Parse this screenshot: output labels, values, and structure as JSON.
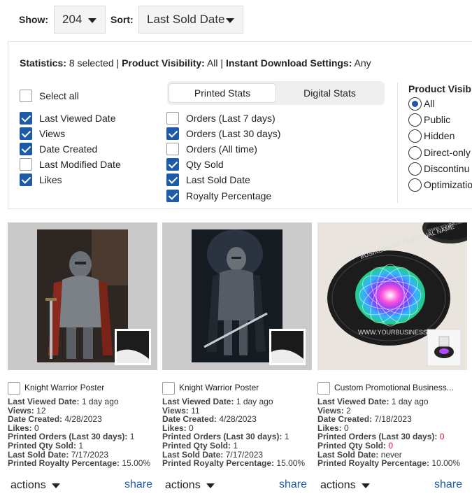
{
  "toolbar": {
    "show_label": "Show:",
    "show_value": "204",
    "sort_label": "Sort:",
    "sort_value": "Last Sold Date"
  },
  "summary": {
    "statistics_label": "Statistics:",
    "statistics_value": "8 selected",
    "sep1": "|",
    "visibility_label": "Product Visibility:",
    "visibility_value": "All",
    "sep2": "|",
    "download_label": "Instant Download Settings:",
    "download_value": "Any"
  },
  "general_stats": {
    "select_all": "Select all",
    "items": [
      {
        "label": "Last Viewed Date",
        "checked": true
      },
      {
        "label": "Views",
        "checked": true
      },
      {
        "label": "Date Created",
        "checked": true
      },
      {
        "label": "Last Modified Date",
        "checked": false
      },
      {
        "label": "Likes",
        "checked": true
      }
    ]
  },
  "tabs": [
    "Printed Stats",
    "Digital Stats"
  ],
  "printed_stats": [
    {
      "label": "Orders (Last 7 days)",
      "checked": false
    },
    {
      "label": "Orders (Last 30 days)",
      "checked": true
    },
    {
      "label": "Orders (All time)",
      "checked": false
    },
    {
      "label": "Qty Sold",
      "checked": true
    },
    {
      "label": "Last Sold Date",
      "checked": true
    },
    {
      "label": "Royalty Percentage",
      "checked": true
    }
  ],
  "visibility": {
    "title": "Product Visibil",
    "options": [
      "All",
      "Public",
      "Hidden",
      "Direct-only",
      "Discontinu",
      "Optimizatio"
    ],
    "selected": "All"
  },
  "stat_labels": {
    "last_viewed": "Last Viewed Date:",
    "views": "Views:",
    "created": "Date Created:",
    "likes": "Likes:",
    "orders30": "Printed Orders (Last 30 days):",
    "qty": "Printed Qty Sold:",
    "last_sold": "Last Sold Date:",
    "royalty": "Printed Royalty Percentage:"
  },
  "products": [
    {
      "title": "Knight Warrior Poster",
      "last_viewed": "1 day ago",
      "views": "12",
      "created": "4/28/2023",
      "likes": "0",
      "orders30": "1",
      "qty": "1",
      "last_sold": "7/17/2023",
      "royalty": "15.00%",
      "actions": "actions",
      "share": "share"
    },
    {
      "title": "Knight Warrior Poster",
      "last_viewed": "1 day ago",
      "views": "11",
      "created": "4/28/2023",
      "likes": "0",
      "orders30": "1",
      "qty": "1",
      "last_sold": "7/17/2023",
      "royalty": "15.00%",
      "actions": "actions",
      "share": "share"
    },
    {
      "title": "Custom Promotional Business...",
      "last_viewed": "1 day ago",
      "views": "2",
      "created": "7/18/2023",
      "likes": "0",
      "orders30": "0",
      "qty": "0",
      "last_sold": "never",
      "royalty": "10.00%",
      "actions": "actions",
      "share": "share"
    }
  ],
  "coaster_text": {
    "top": "BUSINESS OR PERSONAL NAME",
    "bottom": "WWW.YOURBUSINESS.COM",
    "back": "WWW.YOURBUSINESS"
  },
  "colors": {
    "accent": "#1d5aa8",
    "zero_value": "#e0112b"
  }
}
